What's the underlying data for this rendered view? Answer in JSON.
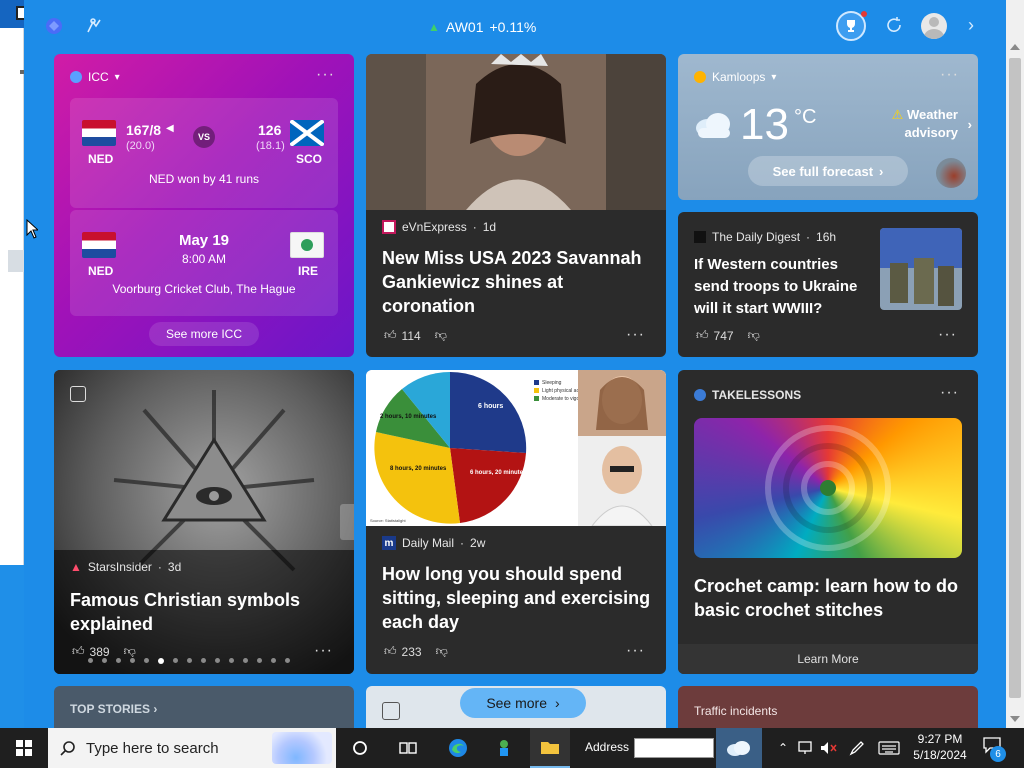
{
  "header": {
    "stock": {
      "symbol": "AW01",
      "change": "+0.11%"
    }
  },
  "icc_card": {
    "title": "ICC",
    "match1": {
      "team_a": "NED",
      "score_a": "167/8",
      "overs_a": "(20.0)",
      "vs": "VS",
      "team_b": "SCO",
      "score_b": "126",
      "overs_b": "(18.1)",
      "result": "NED won by 41 runs"
    },
    "match2": {
      "team_a": "NED",
      "team_b": "IRE",
      "date": "May 19",
      "time": "8:00 AM",
      "venue": "Voorburg Cricket Club, The Hague"
    },
    "see_more": "See more ICC"
  },
  "miss_card": {
    "source": "eVnExpress",
    "age": "1d",
    "headline": "New Miss USA 2023 Savannah Gankiewicz shines at coronation",
    "likes": "114"
  },
  "weather_card": {
    "location": "Kamloops",
    "temp": "13",
    "unit": "°C",
    "advisory_line1": "Weather",
    "advisory_line2": "advisory",
    "forecast_button": "See full forecast"
  },
  "digest_card": {
    "source": "The Daily Digest",
    "age": "16h",
    "headline": "If Western countries send troops to Ukraine will it start WWIII?",
    "likes": "747"
  },
  "symbols_card": {
    "source": "StarsInsider",
    "age": "3d",
    "headline": "Famous Christian symbols explained",
    "likes": "389",
    "page_count": 15,
    "active_page": 5
  },
  "dailymail_card": {
    "source": "Daily Mail",
    "age": "2w",
    "headline": "How long you should spend sitting, sleeping and exercising each day",
    "likes": "233",
    "pie_labels": [
      "6 hours",
      "2 hours, 10 minutes",
      "8 hours, 20 minutes",
      "6 hours, 20 minutes"
    ],
    "legend": [
      "Sleeping",
      "Light physical activity",
      "Moderate to vigorous physical activity"
    ],
    "pie_source": "Source: Statistalight"
  },
  "takelessons_card": {
    "source": "TAKELESSONS",
    "headline": "Crochet camp: learn how to do basic crochet stitches",
    "button": "Learn More"
  },
  "bottom_row": {
    "top_stories": "TOP STORIES",
    "see_more": "See more",
    "traffic": "Traffic incidents"
  },
  "taskbar": {
    "search_placeholder": "Type here to search",
    "address_label": "Address",
    "time": "9:27 PM",
    "date": "5/18/2024",
    "notification_count": "6"
  },
  "colors": {
    "panel_bg": "#1d8ce8",
    "card_bg": "#2b2b2b",
    "icc_gradient_start": "#d11ca6",
    "icc_gradient_end": "#6a16c9",
    "stock_up": "#3fcf6a",
    "warning": "#ffd400"
  }
}
